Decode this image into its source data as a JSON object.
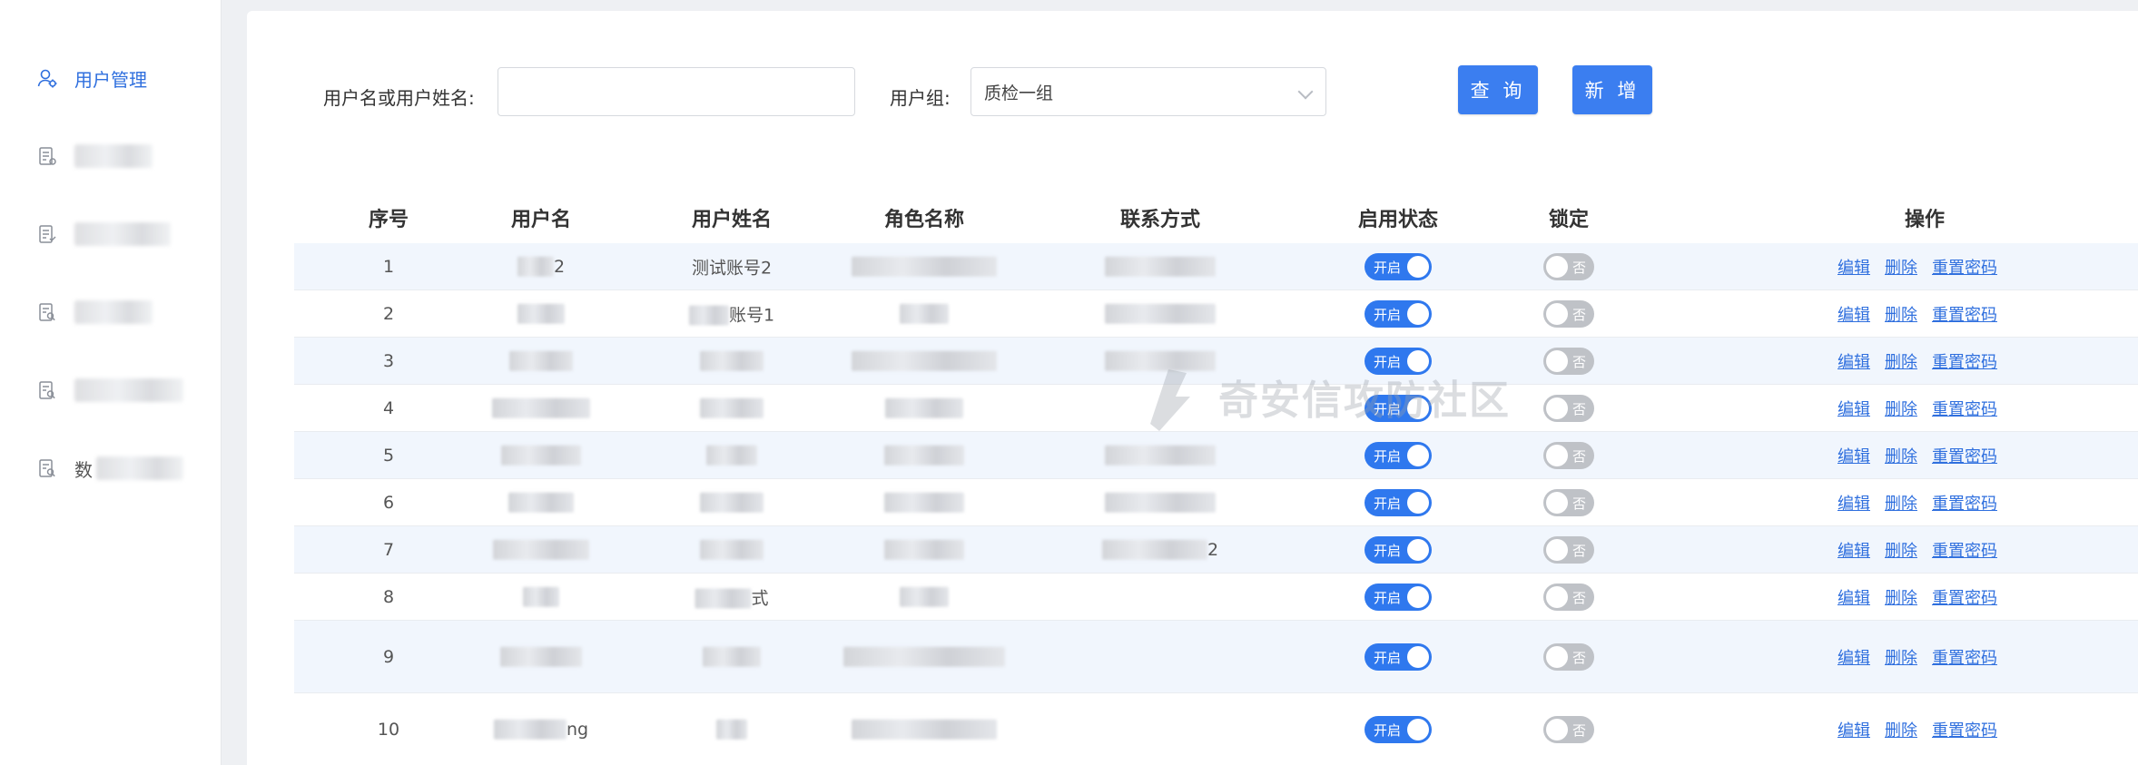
{
  "sidebar": {
    "items": [
      {
        "label": "用户管理",
        "icon": "user-icon",
        "active": true
      },
      {
        "label": "",
        "icon": "document-icon",
        "active": false
      },
      {
        "label": "",
        "icon": "document-list-icon",
        "active": false
      },
      {
        "label": "",
        "icon": "search-doc-icon",
        "active": false
      },
      {
        "label": "",
        "icon": "search-doc-icon",
        "active": false
      },
      {
        "label": "数",
        "icon": "search-doc-icon",
        "active": false
      }
    ]
  },
  "search": {
    "username_label": "用户名或用户姓名:",
    "username_value": "",
    "group_label": "用户组:",
    "group_value": "质检一组",
    "query_button": "查 询",
    "add_button": "新 增"
  },
  "table": {
    "headers": {
      "index": "序号",
      "username": "用户名",
      "fullname": "用户姓名",
      "role": "角色名称",
      "contact": "联系方式",
      "enabled": "启用状态",
      "locked": "锁定",
      "actions": "操作"
    },
    "rows": [
      {
        "index": "1",
        "username": "2",
        "fullname": "测试账号2",
        "enabled_label": "开启",
        "locked_label": "否"
      },
      {
        "index": "2",
        "username": "",
        "fullname": "账号1",
        "enabled_label": "开启",
        "locked_label": "否"
      },
      {
        "index": "3",
        "username": "",
        "fullname": "",
        "enabled_label": "开启",
        "locked_label": "否"
      },
      {
        "index": "4",
        "username": "",
        "fullname": "",
        "enabled_label": "开启",
        "locked_label": "否"
      },
      {
        "index": "5",
        "username": "",
        "fullname": "",
        "enabled_label": "开启",
        "locked_label": "否"
      },
      {
        "index": "6",
        "username": "",
        "fullname": "",
        "enabled_label": "开启",
        "locked_label": "否"
      },
      {
        "index": "7",
        "username": "",
        "fullname": "",
        "contact": "2",
        "enabled_label": "开启",
        "locked_label": "否"
      },
      {
        "index": "8",
        "username": "",
        "fullname": "式",
        "enabled_label": "开启",
        "locked_label": "否"
      },
      {
        "index": "9",
        "username": "",
        "fullname": "",
        "enabled_label": "开启",
        "locked_label": "否"
      },
      {
        "index": "10",
        "username": "ng",
        "fullname": "",
        "enabled_label": "开启",
        "locked_label": "否"
      }
    ],
    "actions": {
      "edit": "编辑",
      "delete": "删除",
      "reset_password": "重置密码"
    }
  },
  "watermark": {
    "text": "奇安信攻防社区"
  },
  "colors": {
    "accent": "#3b7ef0",
    "toggle_on": "#2f78ee",
    "toggle_off": "#bfc2c7",
    "stripe": "#f1f6fd"
  }
}
